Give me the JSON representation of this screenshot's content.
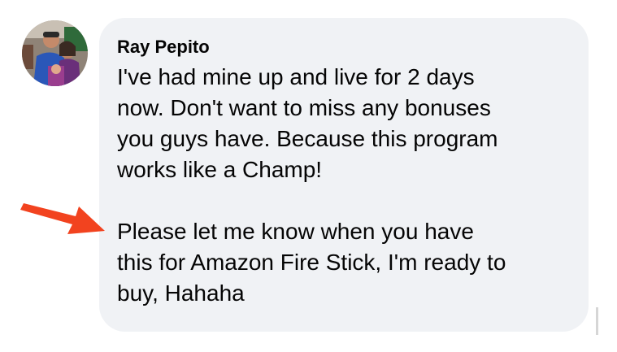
{
  "comment": {
    "author": "Ray Pepito",
    "paragraphs": [
      "I've had mine up and live for 2 days\nnow. Don't want to miss any bonuses\nyou guys have. Because this program\nworks like a Champ!",
      "Please let me know when you have\nthis for Amazon Fire Stick, I'm ready to\nbuy, Hahaha"
    ]
  },
  "annotation": {
    "arrow_color": "#f2431f",
    "arrow_icon": "arrow-right-icon"
  },
  "colors": {
    "bubble_bg": "#f0f2f5",
    "text": "#050505"
  }
}
